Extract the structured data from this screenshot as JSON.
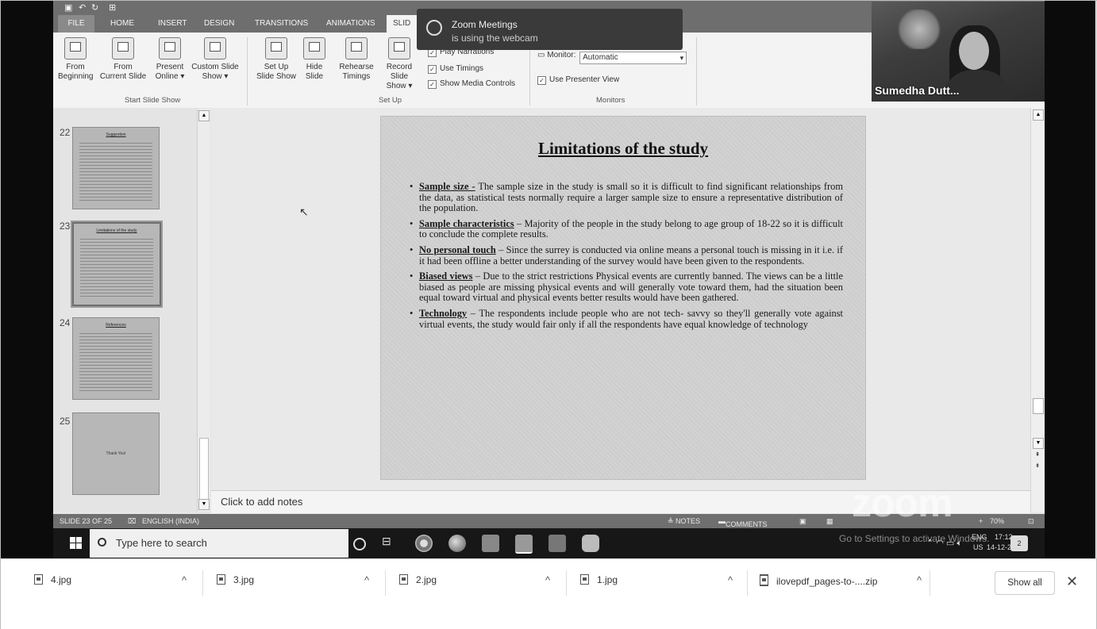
{
  "ribbon": {
    "tabs": [
      "FILE",
      "HOME",
      "INSERT",
      "DESIGN",
      "TRANSITIONS",
      "ANIMATIONS",
      "SLID"
    ],
    "buttons": {
      "from_beginning": [
        "From",
        "Beginning"
      ],
      "from_current": [
        "From",
        "Current Slide"
      ],
      "present_online": [
        "Present",
        "Online ▾"
      ],
      "custom_show": [
        "Custom Slide",
        "Show ▾"
      ],
      "setup_show": [
        "Set Up",
        "Slide Show"
      ],
      "hide_slide": [
        "Hide",
        "Slide"
      ],
      "rehearse": [
        "Rehearse",
        "Timings"
      ],
      "record": [
        "Record Slide",
        "Show ▾"
      ]
    },
    "checkboxes": [
      "Play Narrations",
      "Use Timings",
      "Show Media Controls"
    ],
    "monitor_label": "Monitor:",
    "monitor_value": "Automatic",
    "presenter_view": "Use Presenter View",
    "groups": [
      "Start Slide Show",
      "Set Up",
      "Monitors"
    ]
  },
  "notification": {
    "title": "Zoom Meetings",
    "message": "is using the webcam"
  },
  "video": {
    "participant_name": "Sumedha Dutt..."
  },
  "thumbnails": [
    {
      "num": "22",
      "title": "Suggestion"
    },
    {
      "num": "23",
      "title": "Limitations of the study"
    },
    {
      "num": "24",
      "title": "References"
    },
    {
      "num": "25",
      "title": "Thank You!"
    }
  ],
  "slide": {
    "title": "Limitations of the study",
    "bullets": [
      {
        "head": "Sample size -",
        "text": " The sample size in the study is small so it is difficult to find significant relationships from the data, as statistical tests normally require a larger sample size to ensure a representative distribution of the population."
      },
      {
        "head": "Sample characteristics",
        "text": " – Majority of the people in the study belong to age group of 18-22 so it is difficult to conclude the complete results."
      },
      {
        "head": "No personal touch",
        "text": " – Since the surrey is conducted via online means a personal touch is missing in it i.e. if it had been offline a better understanding of the survey would have been given to the respondents."
      },
      {
        "head": "Biased views",
        "text": " – Due to the strict restrictions Physical events are currently banned. The views can be a little biased as people are missing physical events and will generally vote toward them, had the situation been equal toward virtual and physical events better results would have been gathered."
      },
      {
        "head": "Technology",
        "text": " – The respondents include people who are not tech- savvy so they'll generally vote against virtual events, the study would fair only if all the respondents have equal knowledge of technology"
      }
    ]
  },
  "notes_placeholder": "Click to add notes",
  "status": {
    "slide": "SLIDE 23 OF 25",
    "lang": "ENGLISH (INDIA)",
    "notes": "≜ NOTES",
    "comments": "COMMENTS",
    "zoom": "70%"
  },
  "zoom_watermark": "zoom",
  "taskbar": {
    "search_placeholder": "Type here to search",
    "activate": "Go to Settings to activate Windows.",
    "lang": "ENG",
    "region": "US",
    "time": "17:12",
    "date": "14-12-2020",
    "badge": "2"
  },
  "downloads": {
    "items": [
      "4.jpg",
      "3.jpg",
      "2.jpg",
      "1.jpg",
      "ilovepdf_pages-to-....zip"
    ],
    "show_all": "Show all",
    "close": "✕"
  },
  "colors": {
    "ribbon_bg": "#f3f3f3",
    "status_bg": "#6f6f6f",
    "taskbar_bg": "#171717"
  }
}
